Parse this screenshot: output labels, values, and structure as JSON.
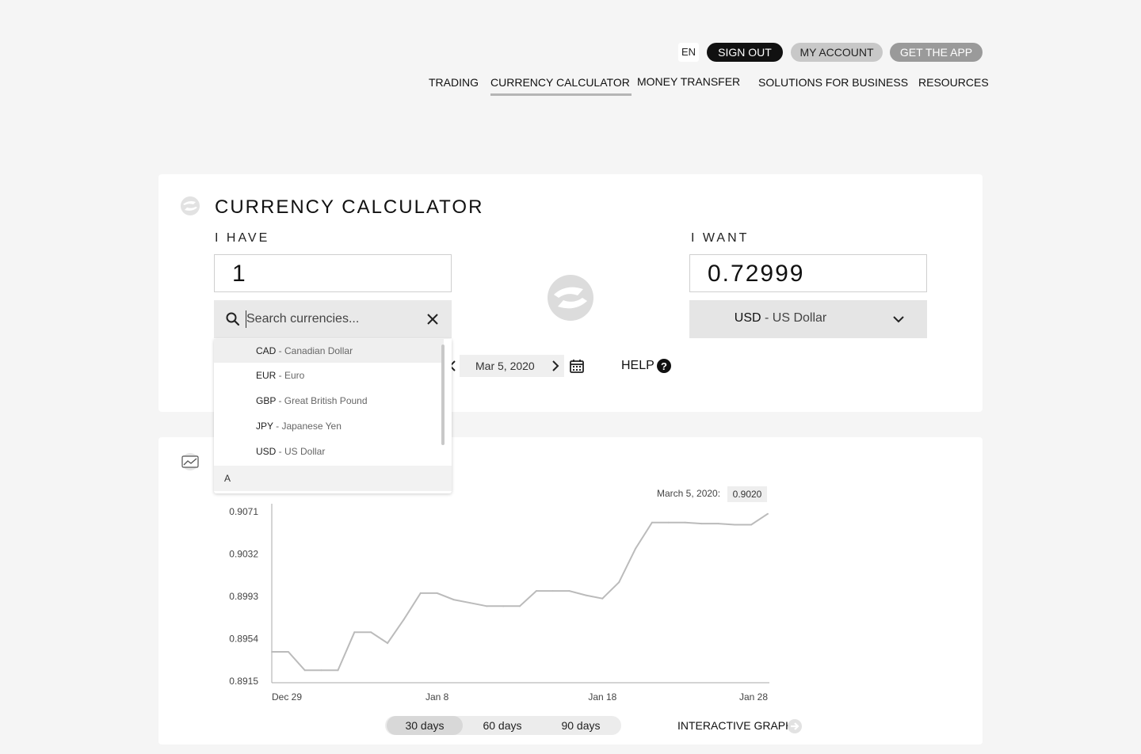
{
  "topbar": {
    "language": "EN",
    "sign_out": "SIGN OUT",
    "my_account": "MY ACCOUNT",
    "get_app": "GET THE APP"
  },
  "nav": {
    "items": [
      "TRADING",
      "CURRENCY CALCULATOR",
      "MONEY TRANSFER",
      "SOLUTIONS FOR BUSINESS",
      "RESOURCES"
    ],
    "active": "CURRENCY CALCULATOR"
  },
  "calculator": {
    "title": "CURRENCY CALCULATOR",
    "have_label": "I HAVE",
    "want_label": "I WANT",
    "have_amount": "1",
    "want_amount": "0.72999",
    "search_placeholder": "Search currencies...",
    "want_currency_code": "USD",
    "want_currency_name": " - US Dollar",
    "date": "Mar 5, 2020",
    "help": "HELP"
  },
  "dropdown": {
    "items": [
      {
        "code": "CAD",
        "name": " - Canadian Dollar"
      },
      {
        "code": "EUR",
        "name": " - Euro"
      },
      {
        "code": "GBP",
        "name": " - Great British Pound"
      },
      {
        "code": "JPY",
        "name": " - Japanese Yen"
      },
      {
        "code": "USD",
        "name": " - US Dollar"
      }
    ],
    "group_header": "A",
    "highlighted_index": 0
  },
  "graph": {
    "tooltip_date": "March 5, 2020:",
    "tooltip_value": "0.9020",
    "ranges": [
      "30 days",
      "60 days",
      "90 days"
    ],
    "active_range": "30 days",
    "interactive_label": "INTERACTIVE GRAPH"
  },
  "chart_data": {
    "type": "line",
    "x": [
      "Dec 29",
      "Dec 30",
      "Dec 31",
      "Jan 1",
      "Jan 2",
      "Jan 3",
      "Jan 4",
      "Jan 5",
      "Jan 6",
      "Jan 7",
      "Jan 8",
      "Jan 9",
      "Jan 10",
      "Jan 11",
      "Jan 12",
      "Jan 13",
      "Jan 14",
      "Jan 15",
      "Jan 16",
      "Jan 17",
      "Jan 18",
      "Jan 19",
      "Jan 20",
      "Jan 21",
      "Jan 22",
      "Jan 23",
      "Jan 24",
      "Jan 25",
      "Jan 26",
      "Jan 27",
      "Jan 28"
    ],
    "values": [
      0.8942,
      0.8942,
      0.8925,
      0.8925,
      0.8925,
      0.896,
      0.896,
      0.895,
      0.8972,
      0.8996,
      0.8996,
      0.899,
      0.8987,
      0.8984,
      0.8984,
      0.8984,
      0.8998,
      0.8998,
      0.8998,
      0.8994,
      0.8991,
      0.9006,
      0.9037,
      0.9061,
      0.9061,
      0.9061,
      0.906,
      0.906,
      0.9059,
      0.9059,
      0.9069
    ],
    "xticks": [
      "Dec 29",
      "Jan 8",
      "Jan 18",
      "Jan 28"
    ],
    "yticks": [
      "0.9071",
      "0.9032",
      "0.8993",
      "0.8954",
      "0.8915"
    ],
    "ylim": [
      0.8915,
      0.9071
    ],
    "grid": false
  }
}
